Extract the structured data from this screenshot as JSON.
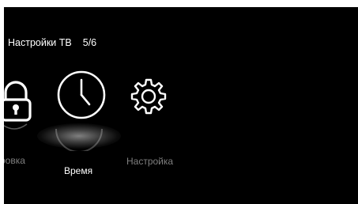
{
  "header": {
    "title": "Настройки ТВ",
    "page_indicator": "5/6"
  },
  "menu": {
    "items": [
      {
        "label": "ровка",
        "icon": "lock-icon",
        "state": "dim"
      },
      {
        "label": "Время",
        "icon": "clock-icon",
        "state": "selected"
      },
      {
        "label": "Настройка",
        "icon": "gear-icon",
        "state": "dim"
      }
    ]
  },
  "colors": {
    "background": "#000000",
    "frame": "#ffffff",
    "text_active": "#ffffff",
    "text_dim": "#7f7f7f",
    "icon": "#ffffff"
  }
}
